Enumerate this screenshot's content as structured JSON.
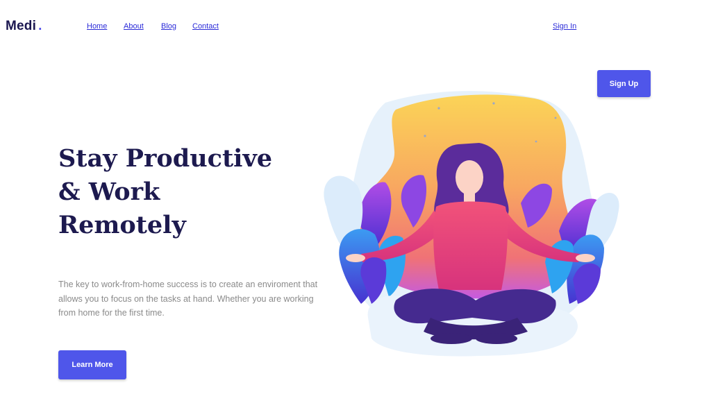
{
  "brand": {
    "name": "Medi",
    "dot": "."
  },
  "nav": {
    "links": [
      "Home",
      "About",
      "Blog",
      "Contact"
    ],
    "sign_in": "Sign In",
    "sign_up": "Sign Up"
  },
  "hero": {
    "title_lines": [
      "Stay Productive",
      "& Work",
      "Remotely"
    ],
    "description": "The key to work-from-home success is to create an enviroment that allows you to focus on the tasks at hand. Whether you are working from home for the first time.",
    "cta": "Learn More"
  },
  "illustration": {
    "subject": "woman meditating cross-legged among leaves"
  },
  "colors": {
    "accent": "#4f56ea",
    "title": "#1d1a4f",
    "link": "#2a2ad8",
    "body_text": "#8a8a8a"
  }
}
